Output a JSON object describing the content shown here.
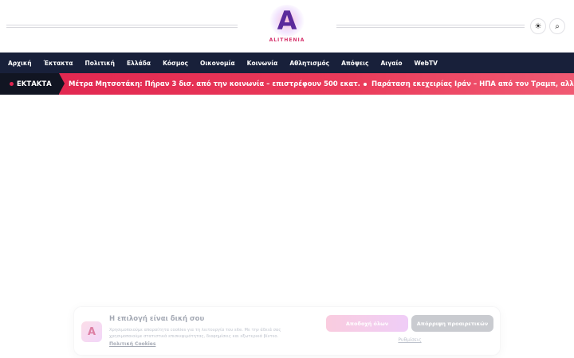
{
  "header": {
    "logo_mark": "A",
    "logo_text": "ALITHENIA",
    "theme_icon": "☀",
    "search_icon": "⌕"
  },
  "nav": {
    "items": [
      "Αρχική",
      "Έκτακτα",
      "Πολιτική",
      "Ελλάδα",
      "Κόσμος",
      "Οικονομία",
      "Κοινωνία",
      "Αθλητισμός",
      "Απόψεις",
      "Αιγαίο",
      "WebTV"
    ]
  },
  "ticker": {
    "label": "ΕΚΤΑΚΤΑ",
    "items": [
      "Μέτρα Μητσοτάκη: Πήραν 3 δισ. από την κοινωνία – επιστρέφουν 500 εκατ.",
      "Παράταση εκεχειρίας Ιράν – ΗΠΑ από τον Τραμπ, αλλά στρατιωτικός ανεφοδιασμός"
    ]
  },
  "cookie": {
    "logo_mark": "A",
    "title": "Η επιλογή είναι δική σου",
    "text": "Χρησιμοποιούμε απαραίτητα cookies για τη λειτουργία του site. Με την άδειά σας χρησιμοποιούμε στατιστικά επισκεψιμότητας, διαφημίσεις και εξωτερικά βίντεο.",
    "policy_link": "Πολιτική Cookies",
    "accept_label": "Αποδοχή όλων",
    "reject_label": "Απόρριψη προαιρετικών",
    "settings_label": "Ρυθμίσεις"
  }
}
